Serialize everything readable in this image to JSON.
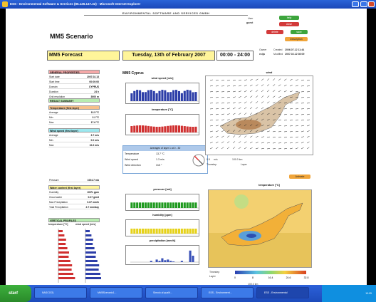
{
  "window": {
    "title": "ESS - Environmental Software & Services (85.126.147.32) - Microsoft Internet Explorer"
  },
  "header": {
    "banner": "ENVIRONMENTAL SOFTWARE AND SERVICES GMBH",
    "user_label": "User",
    "user_value": "guest",
    "owner_label": "Owner",
    "owner_value": "ecija",
    "created_label": "Created",
    "created_value": "2006.07.12 11:44",
    "modified_label": "Modified",
    "modified_value": "2007.02.12 08:09",
    "buttons": {
      "help": "help",
      "close": "close",
      "delete": "delete",
      "save": "save",
      "description": "Description",
      "animate": "Animate"
    }
  },
  "scenario": {
    "title": "MM5 Scenario",
    "forecast": "MM5 Forecast",
    "date": "Tuesday, 13th of February 2007",
    "time_range": "00:00 - 24:00"
  },
  "general": {
    "heading": "GENERAL PROPERTIES",
    "rows": [
      {
        "k": "Start date",
        "v": "2007.02.13"
      },
      {
        "k": "Start time",
        "v": "00:00:00"
      },
      {
        "k": "Domain",
        "v": "CYPRUS"
      },
      {
        "k": "Duration",
        "v": "24 h"
      },
      {
        "k": "Grid resolution",
        "v": "3000 m"
      }
    ]
  },
  "result_summary": {
    "heading": "RESULT SUMMARY",
    "temperature": {
      "heading": "Temperature (first layer)",
      "rows": [
        {
          "k": "Average",
          "v": "13.5 °C"
        },
        {
          "k": "Min",
          "v": "2.2 °C"
        },
        {
          "k": "Max",
          "v": "17.6 °C"
        }
      ]
    },
    "wind": {
      "heading": "Wind speed (first layer)",
      "rows": [
        {
          "k": "Average",
          "v": "3.7 m/s"
        },
        {
          "k": "Min",
          "v": "0.0 m/s"
        },
        {
          "k": "Max",
          "v": "10.2 m/s"
        }
      ]
    },
    "pressure": {
      "k": "Pressure",
      "v": "1004.7 mb"
    },
    "water": {
      "heading": "Water content (first layer)",
      "rows": [
        {
          "k": "Humidity",
          "v": "100% ppm"
        },
        {
          "k": "Cloud water",
          "v": "0.07 g/m3"
        },
        {
          "k": "Max Precipitation",
          "v": "0.67 mm/h"
        },
        {
          "k": "Total Precipitation",
          "v": "2.7 mm/day"
        }
      ]
    },
    "vertical": {
      "heading": "VERTICAL PROFILES",
      "temp_label": "temperature [°C]",
      "wind_label": "wind speed [m/s]"
    }
  },
  "middle": {
    "section_title": "MM5 Cyprus",
    "charts": {
      "wind_speed": "wind speed [m/s]",
      "temperature": "temperature [°C]",
      "pressure": "pressure [mb]",
      "humidity": "humidity [ppm]",
      "precipitation": "precipitation [mm/h]"
    },
    "averages": {
      "heading": "Averages of layer 1 at 0 - 30",
      "rows": [
        {
          "k": "Temperature",
          "v": "13.7 °C"
        },
        {
          "k": "Wind speed",
          "v": "1.3 m/s"
        },
        {
          "k": "Wind direction",
          "v": "315 °"
        }
      ]
    }
  },
  "maps": {
    "wind_title": "wind",
    "temp_title": "temperature [°C]",
    "wind_controls": {
      "scale": "0.5",
      "unit": "m/s",
      "timestep_label": "Timestep",
      "layer_label": "Layer",
      "distance": "100.0 km"
    },
    "temp_controls": {
      "timestep_label": "Timestep",
      "layer_label": "Layer",
      "legend": [
        "0",
        "8",
        "16.4",
        "24.6",
        "32.8"
      ],
      "distance": "100.0 km"
    }
  },
  "taskbar": {
    "start": "start",
    "tasks": [
      "NASCOGL",
      "MM5Scenario1...",
      "Simolo al qualit...",
      "ESS - Environment...",
      "ESS - Environmental"
    ],
    "clock": "10:05"
  },
  "colors": {
    "accent_yellow": "#fff59a",
    "head_red": "#f5a8a8",
    "head_green": "#b8ecb0",
    "head_orange": "#f7c08a",
    "head_cyan": "#9ce8ef",
    "wind_bar": "#2d3ea8",
    "temp_bar": "#d03030",
    "pressure_bar": "#1f9a1f",
    "humidity_bar": "#e6d21a",
    "precip_bar": "#3a52b8"
  }
}
